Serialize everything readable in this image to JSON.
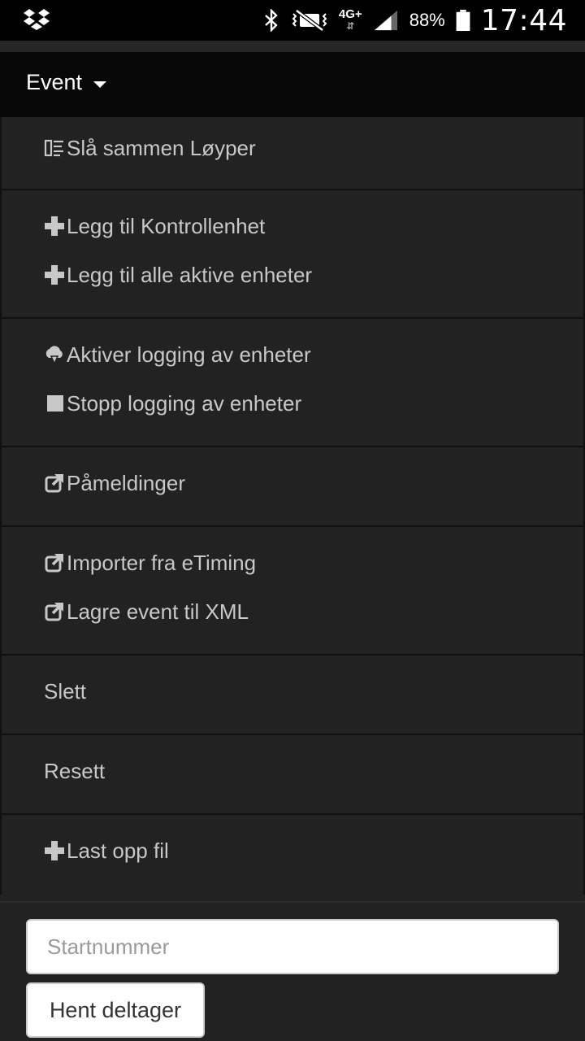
{
  "status_bar": {
    "network": "4G+",
    "battery": "88%",
    "time": "17:44"
  },
  "navbar": {
    "brand": "Event"
  },
  "menu": {
    "groups": [
      {
        "items": [
          {
            "label": "Slå sammen Løyper",
            "icon": "merge-icon"
          }
        ]
      },
      {
        "items": [
          {
            "label": "Legg til Kontrollenhet",
            "icon": "plus-icon"
          },
          {
            "label": "Legg til alle aktive enheter",
            "icon": "plus-icon"
          }
        ]
      },
      {
        "items": [
          {
            "label": "Aktiver logging av enheter",
            "icon": "cloud-download-icon"
          },
          {
            "label": "Stopp logging av enheter",
            "icon": "stop-icon"
          }
        ]
      },
      {
        "items": [
          {
            "label": "Påmeldinger",
            "icon": "external-link-icon"
          }
        ]
      },
      {
        "items": [
          {
            "label": "Importer fra eTiming",
            "icon": "external-link-icon"
          },
          {
            "label": "Lagre event til XML",
            "icon": "external-link-icon"
          }
        ]
      },
      {
        "items": [
          {
            "label": "Slett",
            "icon": ""
          }
        ]
      },
      {
        "items": [
          {
            "label": "Resett",
            "icon": ""
          }
        ]
      },
      {
        "items": [
          {
            "label": "Last opp fil",
            "icon": "plus-icon"
          }
        ]
      }
    ]
  },
  "form": {
    "startnummer_placeholder": "Startnummer",
    "startnummer_value": "",
    "fetch_button": "Hent deltager"
  },
  "colors": {
    "background": "#222222",
    "navbar": "#080808",
    "text": "#c8c8c8",
    "divider": "#111111"
  }
}
